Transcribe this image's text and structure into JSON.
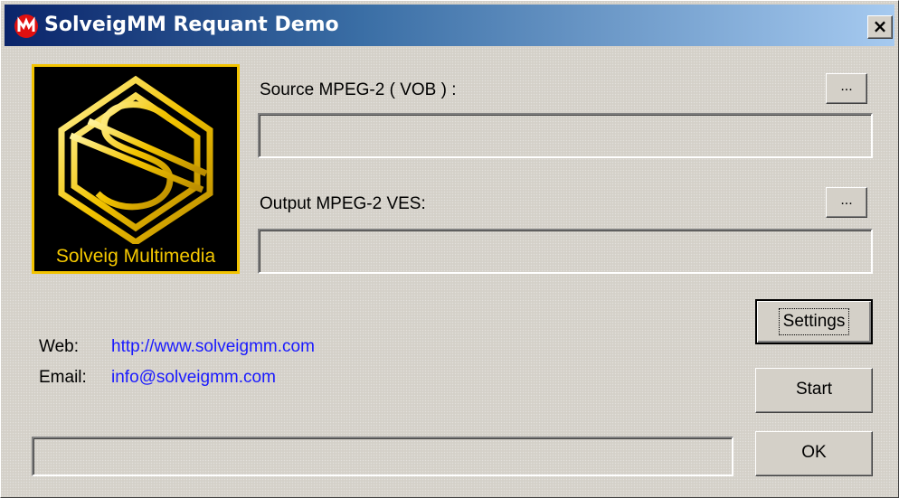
{
  "window": {
    "title": "SolveigMM Requant Demo",
    "close_label": "×"
  },
  "logo": {
    "caption": "Solveig Multimedia"
  },
  "source": {
    "label": "Source MPEG-2 ( VOB ) :",
    "value": "",
    "browse_label": "..."
  },
  "output": {
    "label": "Output MPEG-2 VES:",
    "value": "",
    "browse_label": "..."
  },
  "contact": {
    "web_label": "Web:",
    "web_value": "http://www.solveigmm.com",
    "email_label": "Email:",
    "email_value": "info@solveigmm.com"
  },
  "buttons": {
    "settings": "Settings",
    "start": "Start",
    "ok": "OK"
  },
  "status": {
    "text": ""
  },
  "colors": {
    "title_gradient_start": "#0a246a",
    "title_gradient_end": "#a6caf0",
    "link": "#1a1aff",
    "logo_gold": "#f2c300",
    "face": "#d4d0c8"
  },
  "icons": {
    "app_icon": "solveigmm-app-icon",
    "close": "close-icon"
  }
}
